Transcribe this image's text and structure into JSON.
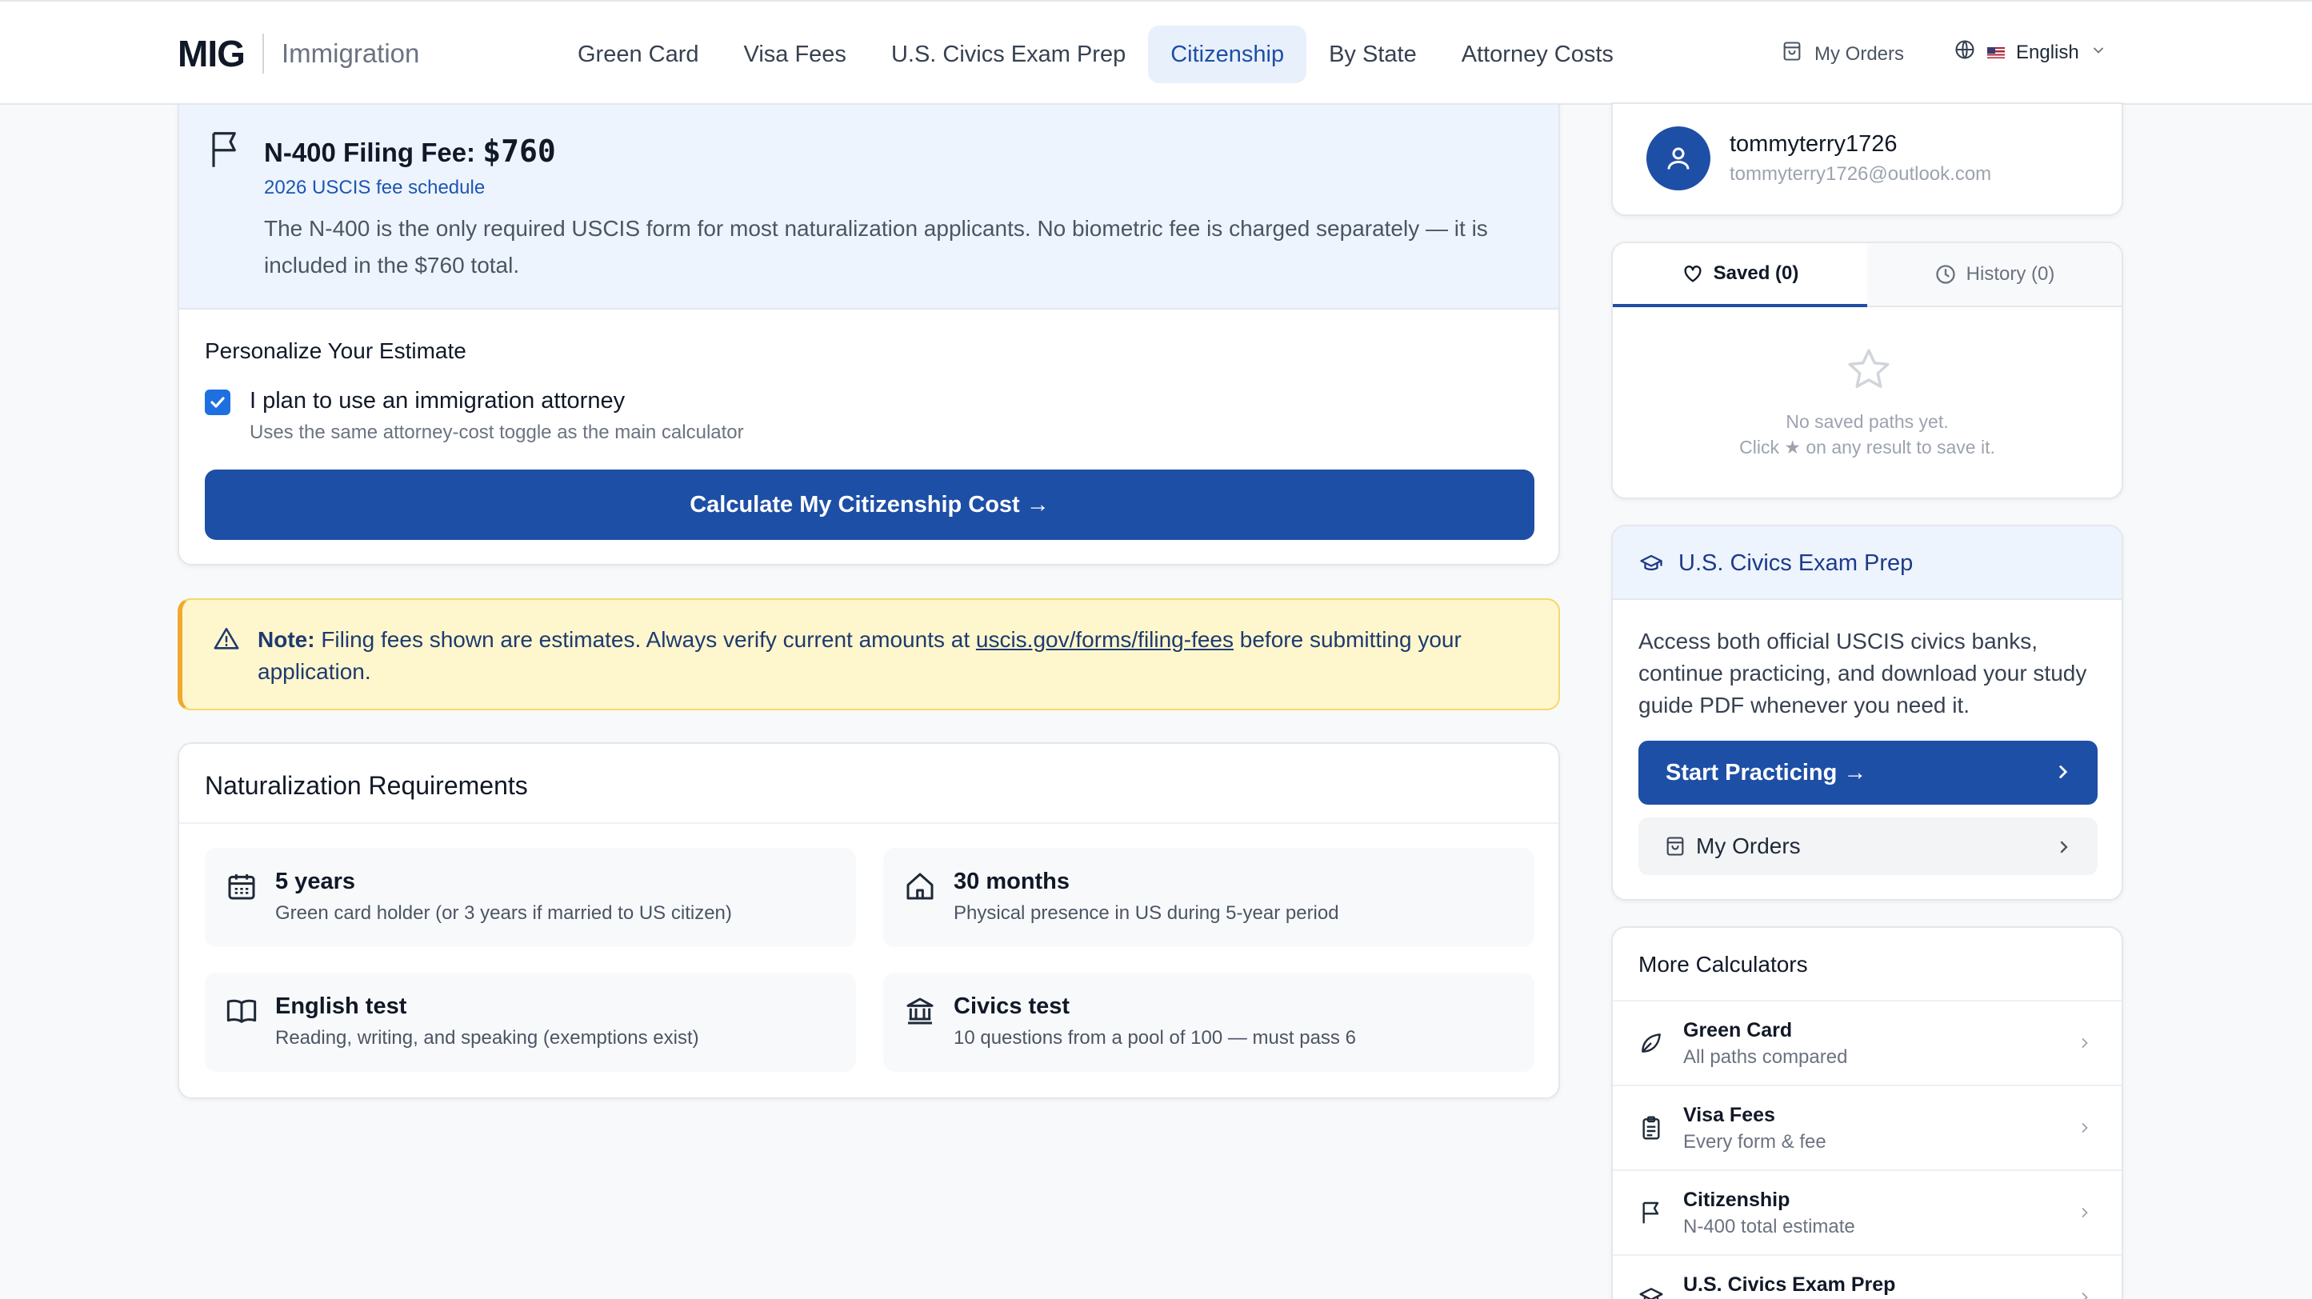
{
  "header": {
    "logo": "MIG",
    "logo_sub": "Immigration",
    "nav": [
      "Green Card",
      "Visa Fees",
      "U.S. Civics Exam Prep",
      "Citizenship",
      "By State",
      "Attorney Costs"
    ],
    "active_nav": "Citizenship",
    "my_orders": "My Orders",
    "language": "English"
  },
  "fee": {
    "title": "N-400 Filing Fee: ",
    "amount": "$760",
    "schedule": "2026 USCIS fee schedule",
    "description": "The N-400 is the only required USCIS form for most naturalization applicants. No biometric fee is charged separately — it is included in the $760 total."
  },
  "estimate": {
    "title": "Personalize Your Estimate",
    "checkbox_label": "I plan to use an immigration attorney",
    "checkbox_checked": true,
    "checkbox_sub": "Uses the same attorney-cost toggle as the main calculator",
    "button": "Calculate My Citizenship Cost →"
  },
  "note": {
    "label": "Note:",
    "text_before": " Filing fees shown are estimates. Always verify current amounts at ",
    "link": "uscis.gov/forms/filing-fees",
    "text_after": " before submitting your application."
  },
  "requirements": {
    "title": "Naturalization Requirements",
    "items": [
      {
        "head": "5 years",
        "sub": "Green card holder (or 3 years if married to US citizen)",
        "icon": "calendar-icon"
      },
      {
        "head": "30 months",
        "sub": "Physical presence in US during 5-year period",
        "icon": "home-icon"
      },
      {
        "head": "English test",
        "sub": "Reading, writing, and speaking (exemptions exist)",
        "icon": "book-icon"
      },
      {
        "head": "Civics test",
        "sub": "10 questions from a pool of 100 — must pass 6",
        "icon": "building-icon"
      }
    ]
  },
  "user": {
    "name": "tommyterry1726",
    "email": "tommyterry1726@outlook.com"
  },
  "saved_tabs": {
    "saved": "Saved (0)",
    "history": "History (0)",
    "empty_line1": "No saved paths yet.",
    "empty_line2": "Click ★ on any result to save it."
  },
  "civics": {
    "title": "U.S. Civics Exam Prep",
    "body": "Access both official USCIS civics banks, continue practicing, and download your study guide PDF whenever you need it.",
    "practice_button": "Start Practicing →",
    "orders_button": "My Orders"
  },
  "more": {
    "title": "More Calculators",
    "items": [
      {
        "title": "Green Card",
        "sub": "All paths compared"
      },
      {
        "title": "Visa Fees",
        "sub": "Every form & fee"
      },
      {
        "title": "Citizenship",
        "sub": "N-400 total estimate"
      },
      {
        "title": "U.S. Civics Exam Prep",
        "sub": ""
      }
    ]
  },
  "colors": {
    "primary": "#1e4fa6",
    "note_bg": "#fef7cd",
    "note_border": "#f0a92e",
    "info_bg": "#edf4fd"
  }
}
